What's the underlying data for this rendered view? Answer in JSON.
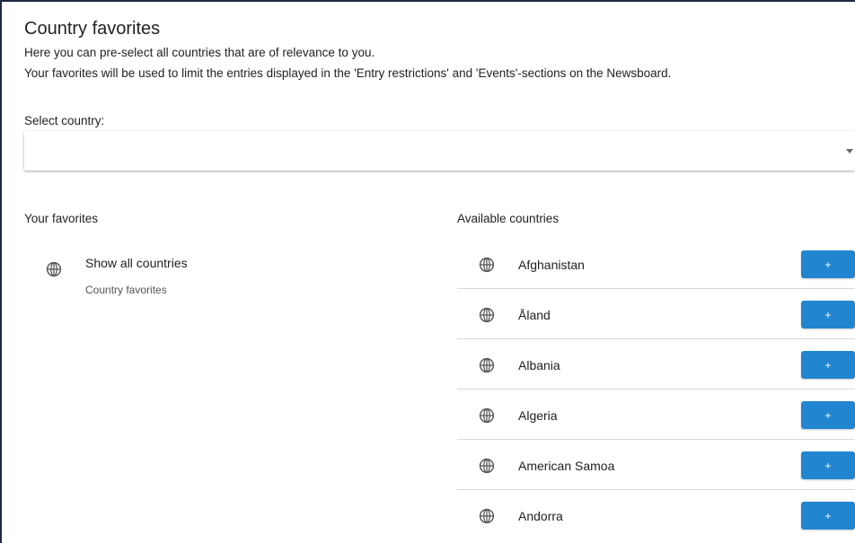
{
  "page": {
    "title": "Country favorites",
    "intro_line1": "Here you can pre-select all countries that are of relevance to you.",
    "intro_line2": "Your favorites will be used to limit the entries displayed in the 'Entry restrictions' and 'Events'-sections on the Newsboard."
  },
  "select": {
    "label": "Select country:",
    "value": "",
    "icon": "caret-down-icon"
  },
  "favorites": {
    "heading": "Your favorites",
    "items": [
      {
        "title": "Show all countries",
        "subtitle": "Country favorites",
        "icon": "globe-icon"
      }
    ]
  },
  "available": {
    "heading": "Available countries",
    "add_label": "+",
    "accent_color": "#2185d0",
    "countries": [
      {
        "name": "Afghanistan",
        "icon": "globe-icon"
      },
      {
        "name": "Åland",
        "icon": "globe-icon"
      },
      {
        "name": "Albania",
        "icon": "globe-icon"
      },
      {
        "name": "Algeria",
        "icon": "globe-icon"
      },
      {
        "name": "American Samoa",
        "icon": "globe-icon"
      },
      {
        "name": "Andorra",
        "icon": "globe-icon"
      }
    ]
  }
}
